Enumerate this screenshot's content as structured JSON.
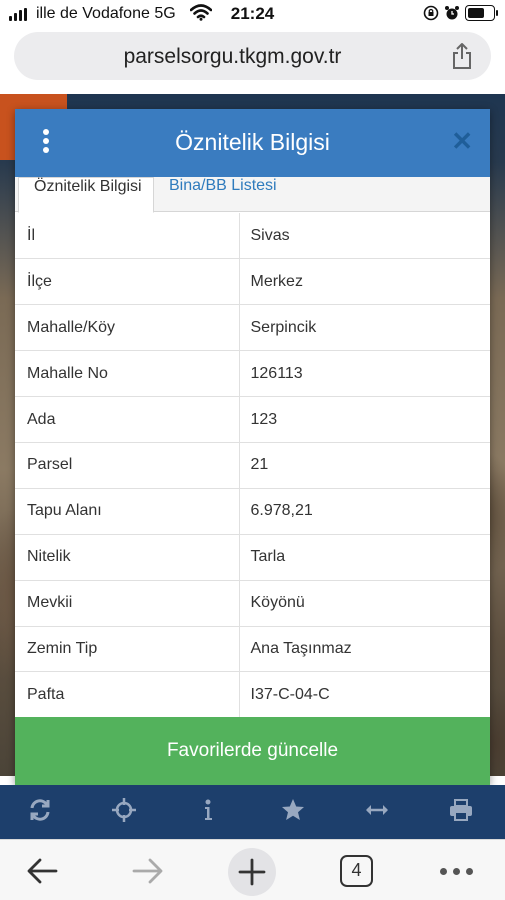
{
  "status_bar": {
    "carrier": "ille de Vodafone 5G",
    "time": "21:24",
    "icons": [
      "signal-icon",
      "wifi-icon",
      "rotation-lock-icon",
      "alarm-icon",
      "battery-icon"
    ]
  },
  "browser": {
    "url": "parselsorgu.tkgm.gov.tr",
    "tab_count": "4"
  },
  "dialog": {
    "title": "Öznitelik Bilgisi",
    "tabs": [
      {
        "label": "Öznitelik Bilgisi",
        "active": true
      },
      {
        "label": "Bina/BB Listesi",
        "active": false
      }
    ],
    "rows": [
      {
        "key": "İl",
        "value": "Sivas"
      },
      {
        "key": "İlçe",
        "value": "Merkez"
      },
      {
        "key": "Mahalle/Köy",
        "value": "Serpincik"
      },
      {
        "key": "Mahalle No",
        "value": "126113"
      },
      {
        "key": "Ada",
        "value": "123"
      },
      {
        "key": "Parsel",
        "value": "21"
      },
      {
        "key": "Tapu Alanı",
        "value": "6.978,21"
      },
      {
        "key": "Nitelik",
        "value": "Tarla"
      },
      {
        "key": "Mevkii",
        "value": "Köyönü"
      },
      {
        "key": "Zemin Tip",
        "value": "Ana Taşınmaz"
      },
      {
        "key": "Pafta",
        "value": "I37-C-04-C"
      }
    ],
    "button_label": "Favorilerde güncelle"
  },
  "map_toolbar": {
    "icons": [
      "refresh-icon",
      "crosshair-icon",
      "info-icon",
      "star-icon",
      "measure-icon",
      "print-icon"
    ]
  },
  "colors": {
    "header_blue": "#3a7cc0",
    "button_green": "#53b25c",
    "toolbar_navy": "#1d3f6c",
    "link_blue": "#2f7bbd"
  }
}
